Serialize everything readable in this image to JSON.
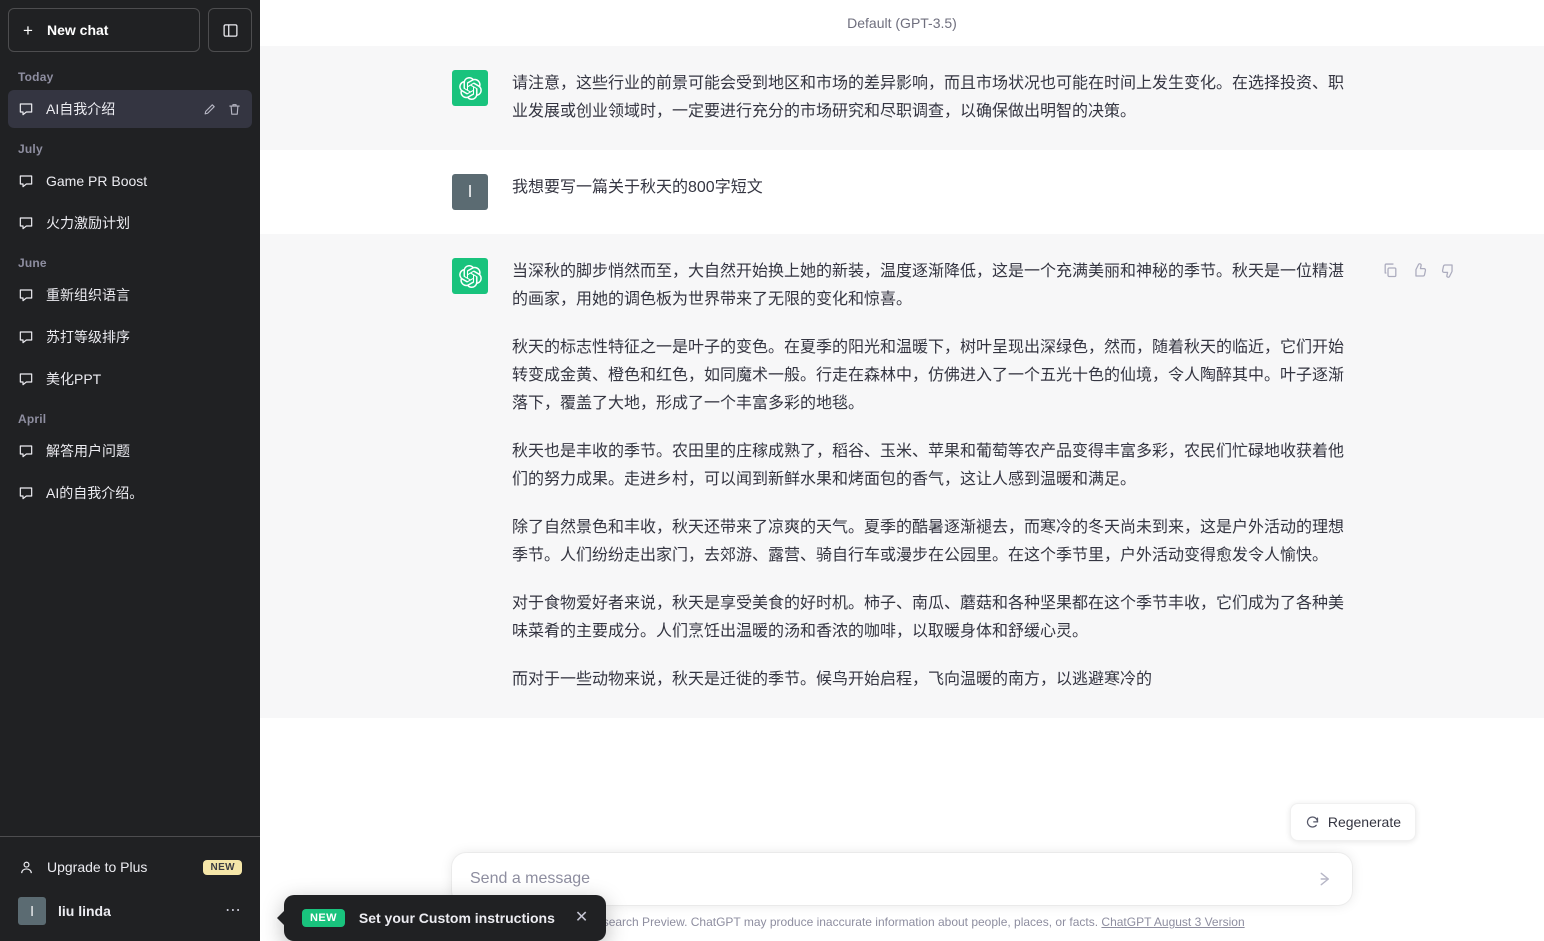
{
  "sidebar": {
    "new_chat_label": "New chat",
    "toggle_icon": "sidebar-panel-icon",
    "groups": [
      {
        "label": "Today",
        "items": [
          {
            "title": "AI自我介绍",
            "active": true,
            "icon": "chat-bubble-icon"
          }
        ]
      },
      {
        "label": "July",
        "items": [
          {
            "title": "Game PR Boost",
            "active": false,
            "icon": "chat-bubble-icon"
          },
          {
            "title": "火力激励计划",
            "active": false,
            "icon": "chat-bubble-icon"
          }
        ]
      },
      {
        "label": "June",
        "items": [
          {
            "title": "重新组织语言",
            "active": false,
            "icon": "chat-bubble-icon"
          },
          {
            "title": "苏打等级排序",
            "active": false,
            "icon": "chat-bubble-icon"
          },
          {
            "title": "美化PPT",
            "active": false,
            "icon": "chat-bubble-icon"
          }
        ]
      },
      {
        "label": "April",
        "items": [
          {
            "title": "解答用户问题",
            "active": false,
            "icon": "chat-bubble-icon"
          },
          {
            "title": "AI的自我介绍。",
            "active": false,
            "icon": "chat-bubble-icon"
          }
        ]
      }
    ],
    "row_actions": {
      "edit_icon": "pencil-icon",
      "delete_icon": "trash-icon"
    },
    "upgrade": {
      "label": "Upgrade to Plus",
      "badge": "NEW",
      "icon": "person-icon"
    },
    "account": {
      "name": "liu linda",
      "avatar_letter": "l",
      "menu_icon": "ellipsis-icon"
    }
  },
  "header": {
    "model_label": "Default (GPT-3.5)"
  },
  "thread": {
    "messages": [
      {
        "role": "assistant",
        "avatar": "openai-logo-icon",
        "partial_top": true,
        "paragraphs": [
          "请注意，这些行业的前景可能会受到地区和市场的差异影响，而且市场状况也可能在时间上发生变化。在选择投资、职业发展或创业领域时，一定要进行充分的市场研究和尽职调查，以确保做出明智的决策。"
        ]
      },
      {
        "role": "user",
        "avatar_letter": "l",
        "paragraphs": [
          "我想要写一篇关于秋天的800字短文"
        ]
      },
      {
        "role": "assistant",
        "avatar": "openai-logo-icon",
        "actions": [
          "copy-icon",
          "thumbs-up-icon",
          "thumbs-down-icon"
        ],
        "paragraphs": [
          "当深秋的脚步悄然而至，大自然开始换上她的新装，温度逐渐降低，这是一个充满美丽和神秘的季节。秋天是一位精湛的画家，用她的调色板为世界带来了无限的变化和惊喜。",
          "秋天的标志性特征之一是叶子的变色。在夏季的阳光和温暖下，树叶呈现出深绿色，然而，随着秋天的临近，它们开始转变成金黄、橙色和红色，如同魔术一般。行走在森林中，仿佛进入了一个五光十色的仙境，令人陶醉其中。叶子逐渐落下，覆盖了大地，形成了一个丰富多彩的地毯。",
          "秋天也是丰收的季节。农田里的庄稼成熟了，稻谷、玉米、苹果和葡萄等农产品变得丰富多彩，农民们忙碌地收获着他们的努力成果。走进乡村，可以闻到新鲜水果和烤面包的香气，这让人感到温暖和满足。",
          "除了自然景色和丰收，秋天还带来了凉爽的天气。夏季的酷暑逐渐褪去，而寒冷的冬天尚未到来，这是户外活动的理想季节。人们纷纷走出家门，去郊游、露营、骑自行车或漫步在公园里。在这个季节里，户外活动变得愈发令人愉快。",
          "对于食物爱好者来说，秋天是享受美食的好时机。柿子、南瓜、蘑菇和各种坚果都在这个季节丰收，它们成为了各种美味菜肴的主要成分。人们烹饪出温暖的汤和香浓的咖啡，以取暖身体和舒缓心灵。"
        ],
        "clipped_paragraph": "而对于一些动物来说，秋天是迁徙的季节。候鸟开始启程，飞向温暖的南方，以逃避寒冷的"
      }
    ]
  },
  "regenerate": {
    "label": "Regenerate",
    "icon": "refresh-icon"
  },
  "composer": {
    "placeholder": "Send a message",
    "value": "",
    "send_icon": "send-arrow-icon"
  },
  "footer": {
    "note": "Free Research Preview. ChatGPT may produce inaccurate information about people, places, or facts.",
    "link": "ChatGPT August 3 Version"
  },
  "toast": {
    "badge": "NEW",
    "label": "Set your Custom instructions",
    "close_icon": "close-icon"
  },
  "colors": {
    "sidebar_bg": "#202123",
    "sidebar_active": "#343541",
    "assistant_bg": "#f7f7f8",
    "user_bg": "#ffffff",
    "brand_green": "#19c37d",
    "user_avatar": "#5b6b72",
    "badge_yellow": "#f5e6a8",
    "text_primary": "#343541",
    "text_muted": "#8e8ea0"
  }
}
